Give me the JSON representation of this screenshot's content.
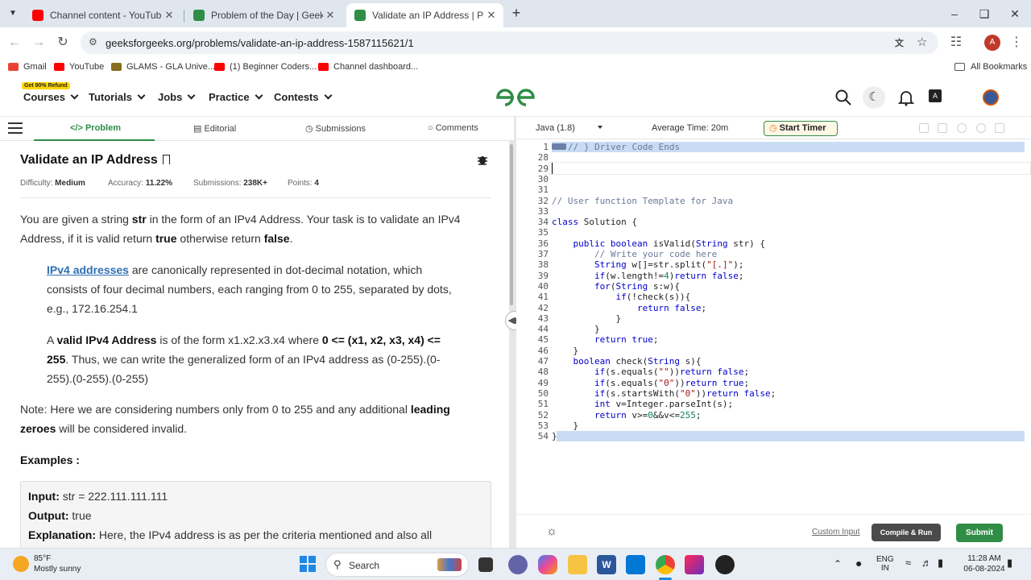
{
  "browser": {
    "tabs": [
      {
        "title": "Channel content - YouTube Stu",
        "favicon_color": "#ff0000",
        "active": false
      },
      {
        "title": "Problem of the Day | GeeksforG",
        "favicon_color": "#2f8d46",
        "active": false
      },
      {
        "title": "Validate an IP Address | Practic",
        "favicon_color": "#2f8d46",
        "active": true
      }
    ],
    "url": "geeksforgeeks.org/problems/validate-an-ip-address-1587115621/1",
    "bookmarks": [
      {
        "label": "Gmail",
        "color": "#ea4335"
      },
      {
        "label": "YouTube",
        "color": "#ff0000"
      },
      {
        "label": "GLAMS - GLA Unive...",
        "color": "#8a6d1d"
      },
      {
        "label": "(1) Beginner Coders...",
        "color": "#ff0000"
      },
      {
        "label": "Channel dashboard...",
        "color": "#ff0000"
      }
    ],
    "all_bookmarks": "All Bookmarks",
    "profile_initial": "A"
  },
  "site": {
    "refund_badge": "Get 90% Refund",
    "menu": [
      "Courses",
      "Tutorials",
      "Jobs",
      "Practice",
      "Contests"
    ],
    "brand_color": "#2f8d46"
  },
  "problem": {
    "tabs": [
      {
        "label": "Problem",
        "icon": "</>"
      },
      {
        "label": "Editorial",
        "icon": "doc"
      },
      {
        "label": "Submissions",
        "icon": "clock"
      },
      {
        "label": "Comments",
        "icon": "chat"
      }
    ],
    "title": "Validate an IP Address",
    "difficulty_label": "Difficulty:",
    "difficulty": "Medium",
    "accuracy_label": "Accuracy:",
    "accuracy": "11.22%",
    "submissions_label": "Submissions:",
    "submissions": "238K+",
    "points_label": "Points:",
    "points": "4",
    "p1_a": "You are given a string ",
    "p1_str": "str",
    "p1_b": " in the form of an IPv4 Address. Your task is to validate an IPv4 Address, if it is valid return ",
    "p1_true": "true",
    "p1_c": " otherwise return ",
    "p1_false": "false",
    "p1_d": ".",
    "p2_link": "IPv4 addresses",
    "p2_rest": " are canonically represented in dot-decimal notation, which consists of four decimal numbers, each ranging from 0 to 255, separated by dots, e.g., 172.16.254.1",
    "p3_a": "A ",
    "p3_bold": "valid IPv4 Address",
    "p3_b": " is of the form x1.x2.x3.x4 where ",
    "p3_cond": "0 <= (x1, x2, x3, x4) <= 255",
    "p3_c": ". Thus, we can write the generalized form of an IPv4 address as (0-255).(0-255).(0-255).(0-255)",
    "note_a": "Note: Here we are considering numbers only from 0 to 255 and any additional ",
    "note_bold": "leading zeroes",
    "note_b": " will be considered invalid.",
    "examples_heading": "Examples :",
    "ex_input_label": "Input:",
    "ex_input": " str =  222.111.111.111",
    "ex_output_label": "Output:",
    "ex_output": " true",
    "ex_expl_label": "Explanation:",
    "ex_expl": "  Here, the IPv4 address is as per the criteria mentioned and also all"
  },
  "editor": {
    "language": "Java (1.8)",
    "avg_time": "Average Time: 20m",
    "start_timer": "Start Timer",
    "lines": [
      {
        "n": "1",
        "code": "// } Driver Code Ends"
      },
      {
        "n": "28",
        "code": ""
      },
      {
        "n": "29",
        "code": ""
      },
      {
        "n": "30",
        "code": ""
      },
      {
        "n": "31",
        "code": ""
      },
      {
        "n": "32",
        "code": "// User function Template for Java"
      },
      {
        "n": "33",
        "code": ""
      },
      {
        "n": "34",
        "code": "class Solution {"
      },
      {
        "n": "35",
        "code": ""
      },
      {
        "n": "36",
        "code": "    public boolean isValid(String str) {"
      },
      {
        "n": "37",
        "code": "        // Write your code here"
      },
      {
        "n": "38",
        "code": "        String w[]=str.split(\"[.]\");"
      },
      {
        "n": "39",
        "code": "        if(w.length!=4)return false;"
      },
      {
        "n": "40",
        "code": "        for(String s:w){"
      },
      {
        "n": "41",
        "code": "            if(!check(s)){"
      },
      {
        "n": "42",
        "code": "                return false;"
      },
      {
        "n": "43",
        "code": "            }"
      },
      {
        "n": "44",
        "code": "        }"
      },
      {
        "n": "45",
        "code": "        return true;"
      },
      {
        "n": "46",
        "code": "    }"
      },
      {
        "n": "47",
        "code": "    boolean check(String s){"
      },
      {
        "n": "48",
        "code": "        if(s.equals(\"\"))return false;"
      },
      {
        "n": "49",
        "code": "        if(s.equals(\"0\"))return true;"
      },
      {
        "n": "50",
        "code": "        if(s.startsWith(\"0\"))return false;"
      },
      {
        "n": "51",
        "code": "        int v=Integer.parseInt(s);"
      },
      {
        "n": "52",
        "code": "        return v>=0&&v<=255;"
      },
      {
        "n": "53",
        "code": "    }"
      },
      {
        "n": "54",
        "code": "}"
      }
    ],
    "custom_input": "Custom Input",
    "compile_run": "Compile & Run",
    "submit": "Submit"
  },
  "taskbar": {
    "weather_temp": "85°F",
    "weather_desc": "Mostly sunny",
    "search_placeholder": "Search",
    "lang_top": "ENG",
    "lang_bottom": "IN",
    "time": "11:28 AM",
    "date": "06-08-2024"
  }
}
